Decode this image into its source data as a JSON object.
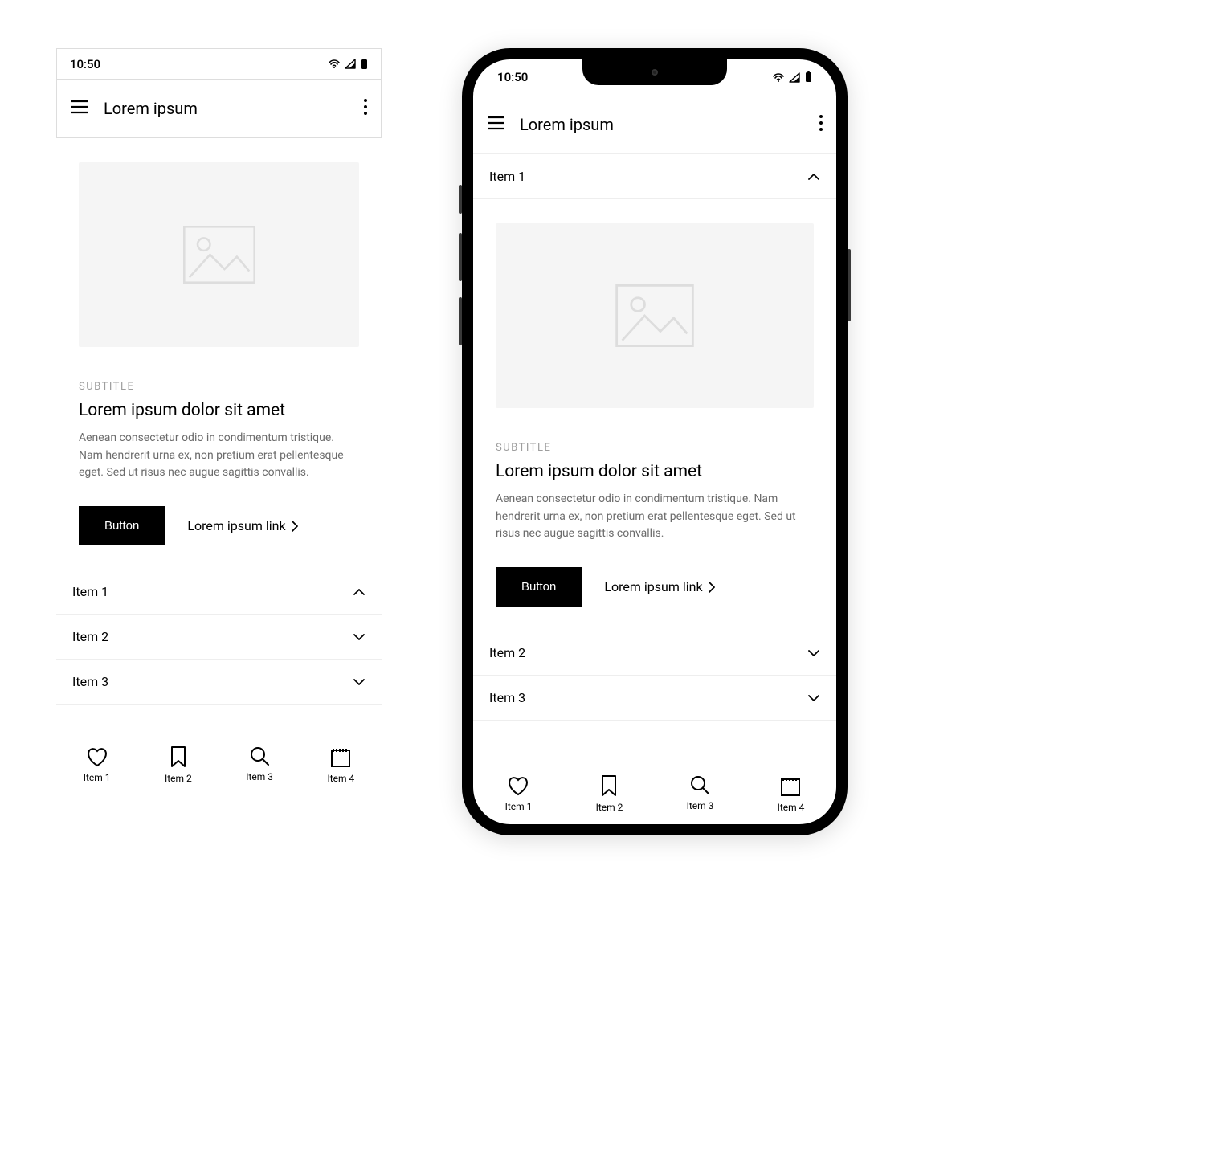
{
  "status": {
    "time": "10:50"
  },
  "appbar": {
    "title": "Lorem ipsum"
  },
  "card": {
    "subtitle": "SUBTITLE",
    "title": "Lorem ipsum dolor sit amet",
    "desc": "Aenean consectetur odio in condimentum tristique. Nam hendrerit urna ex, non pretium erat pellentesque eget. Sed ut risus nec augue sagittis convallis.",
    "button": "Button",
    "link": "Lorem ipsum link"
  },
  "accordion": {
    "items": [
      {
        "label": "Item 1",
        "expanded": true
      },
      {
        "label": "Item 2",
        "expanded": false
      },
      {
        "label": "Item 3",
        "expanded": false
      }
    ]
  },
  "bottomnav": {
    "items": [
      {
        "label": "Item 1",
        "icon": "heart-icon"
      },
      {
        "label": "Item 2",
        "icon": "bookmark-icon"
      },
      {
        "label": "Item 3",
        "icon": "search-icon"
      },
      {
        "label": "Item 4",
        "icon": "calendar-icon"
      }
    ]
  }
}
